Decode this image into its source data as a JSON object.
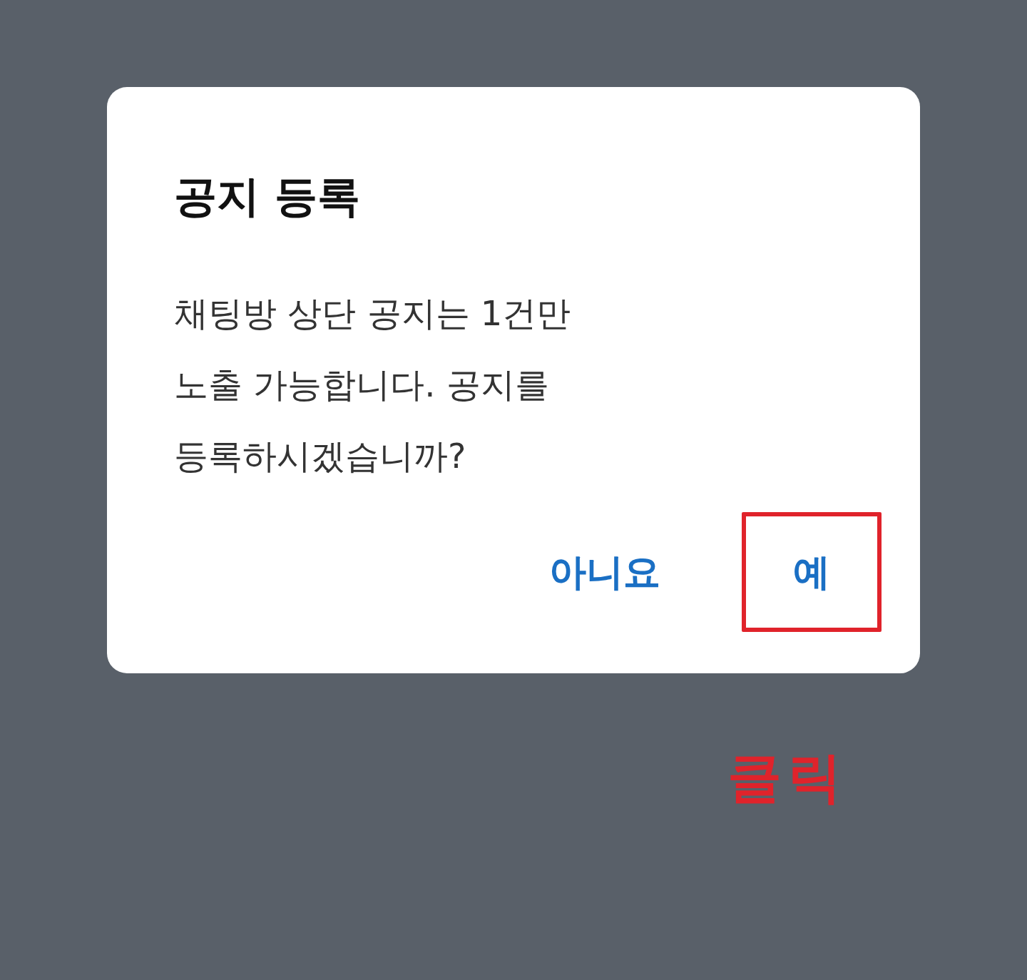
{
  "dialog": {
    "title": "공지 등록",
    "message": "채팅방 상단 공지는 1건만\n노출 가능합니다. 공지를\n등록하시겠습니까?",
    "buttons": [
      {
        "label": "아니요",
        "highlighted": false
      },
      {
        "label": "예",
        "highlighted": true
      }
    ]
  },
  "annotation": {
    "label": "클릭"
  }
}
